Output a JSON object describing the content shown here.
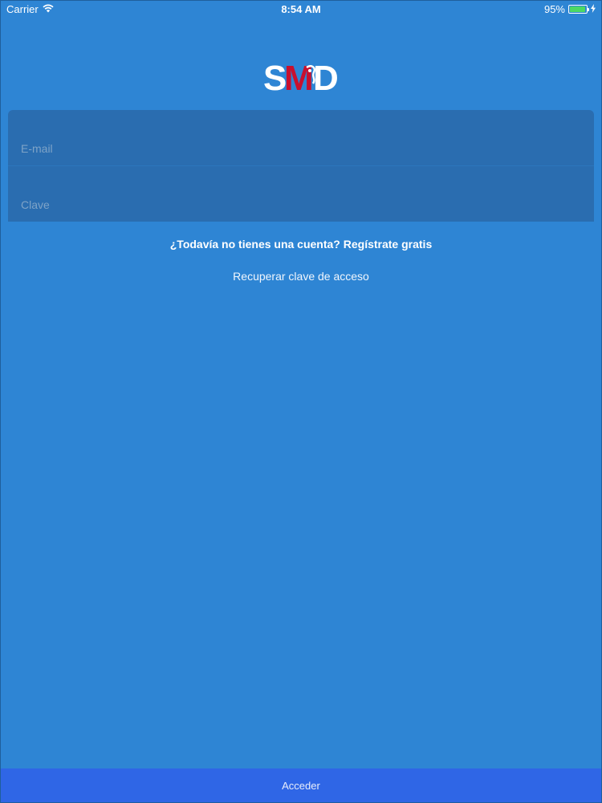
{
  "status_bar": {
    "carrier": "Carrier",
    "time": "8:54 AM",
    "battery_text": "95%",
    "battery_level": 0.95,
    "icons": [
      "wifi-icon",
      "battery-icon",
      "charging-icon"
    ]
  },
  "brand": {
    "logo_text": "SMD",
    "logo_colors": {
      "primary": "#ffffff",
      "accent": "#c8102e"
    }
  },
  "login_form": {
    "email_placeholder": "E-mail",
    "email_value": "",
    "password_placeholder": "Clave",
    "password_value": ""
  },
  "links": {
    "signup": "¿Todavía no tienes una cuenta? Regístrate gratis",
    "recover": "Recuperar clave de acceso"
  },
  "footer": {
    "access_label": "Acceder"
  },
  "colors": {
    "background": "#2e85d4",
    "field_background": "#2a6db0",
    "access_bar": "#2f66e6",
    "battery_fill": "#4cd964"
  }
}
